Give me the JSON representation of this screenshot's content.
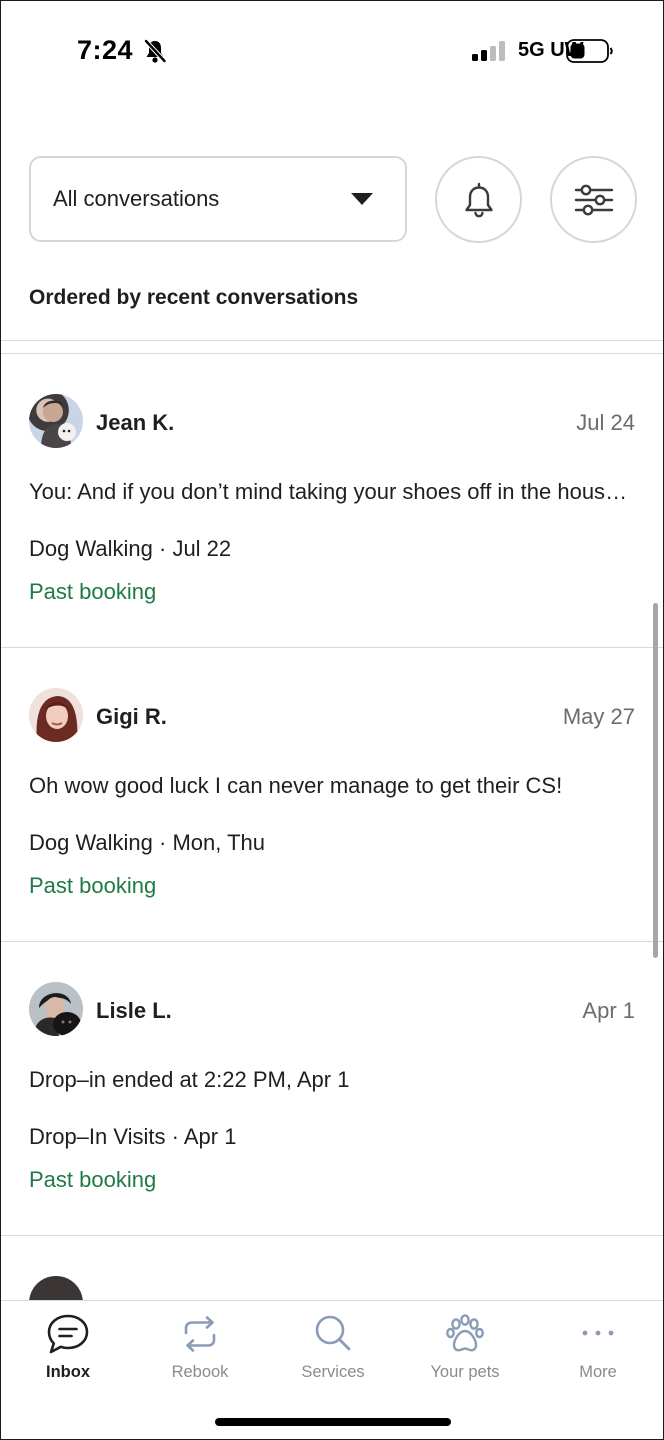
{
  "status_bar": {
    "time": "7:24",
    "network": "5G UW",
    "icons": [
      "bell-slash-icon",
      "signal-icon",
      "battery-icon"
    ]
  },
  "filter": {
    "selected": "All conversations",
    "order_label": "Ordered by recent conversations",
    "icons": [
      "notification-bell-icon",
      "filter-sliders-icon"
    ]
  },
  "conversations": [
    {
      "name": "Jean K.",
      "date": "Jul 24",
      "preview": "You: And if you don’t mind taking your shoes off in the house, that would be great!",
      "service": "Dog Walking · Jul 22",
      "status": "Past booking"
    },
    {
      "name": "Gigi R.",
      "date": "May 27",
      "preview": "Oh wow good luck I can never manage to get their CS!",
      "service": "Dog Walking · Mon, Thu",
      "status": "Past booking"
    },
    {
      "name": "Lisle L.",
      "date": "Apr 1",
      "preview": "Drop–in ended at 2:22 PM, Apr 1",
      "service": "Drop–In Visits · Apr 1",
      "status": "Past booking"
    }
  ],
  "bottom_nav": [
    {
      "label": "Inbox",
      "icon": "chat-bubble-icon",
      "active": true
    },
    {
      "label": "Rebook",
      "icon": "rebook-arrows-icon",
      "active": false
    },
    {
      "label": "Services",
      "icon": "search-icon",
      "active": false
    },
    {
      "label": "Your pets",
      "icon": "paw-icon",
      "active": false
    },
    {
      "label": "More",
      "icon": "more-dots-icon",
      "active": false
    }
  ],
  "colors": {
    "accent_green": "#1f7a45",
    "text_primary": "#1f1f23",
    "text_muted": "#6b6b72",
    "border": "#d6d6da"
  }
}
